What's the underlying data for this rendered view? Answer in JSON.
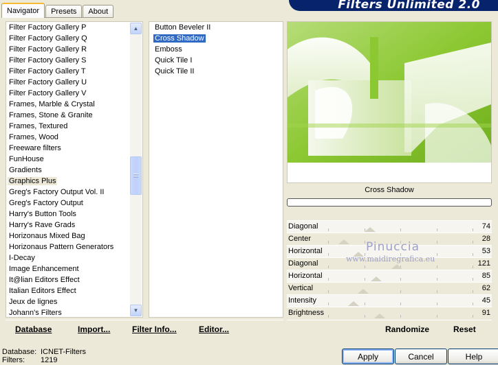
{
  "tabs": [
    {
      "label": "Navigator",
      "active": true
    },
    {
      "label": "Presets",
      "active": false
    },
    {
      "label": "About",
      "active": false
    }
  ],
  "banner_title": "Filters Unlimited 2.0",
  "categories": [
    "Filter Factory Gallery P",
    "Filter Factory Gallery Q",
    "Filter Factory Gallery R",
    "Filter Factory Gallery S",
    "Filter Factory Gallery T",
    "Filter Factory Gallery U",
    "Filter Factory Gallery V",
    "Frames, Marble & Crystal",
    "Frames, Stone & Granite",
    "Frames, Textured",
    "Frames, Wood",
    "Freeware filters",
    "FunHouse",
    "Gradients",
    "Graphics Plus",
    "Greg's Factory Output Vol. II",
    "Greg's Factory Output",
    "Harry's Button Tools",
    "Harry's Rave Grads",
    "Horizonaus Mixed Bag",
    "Horizonaus Pattern Generators",
    "I-Decay",
    "Image Enhancement",
    "It@lian Editors Effect",
    "Italian Editors Effect",
    "Jeux de lignes",
    "Johann's Filters"
  ],
  "selected_category": "Graphics Plus",
  "filters": [
    "Button Beveler II",
    "Cross Shadow",
    "Emboss",
    "Quick Tile I",
    "Quick Tile II"
  ],
  "selected_filter": "Cross Shadow",
  "left_bar": {
    "database": "Database",
    "import": "Import...",
    "filter_info": "Filter Info...",
    "editor": "Editor..."
  },
  "preview_caption": "Cross Shadow",
  "progress": 0,
  "sliders": [
    {
      "label": "Diagonal",
      "value": "74"
    },
    {
      "label": "Center",
      "value": "28"
    },
    {
      "label": "Horizontal",
      "value": "53"
    },
    {
      "label": "Diagonal",
      "value": "121"
    },
    {
      "label": "Horizontal",
      "value": "85"
    },
    {
      "label": "Vertical",
      "value": "62"
    },
    {
      "label": "Intensity",
      "value": "45"
    },
    {
      "label": "Brightness",
      "value": "91"
    }
  ],
  "right_bar": {
    "randomize": "Randomize",
    "reset": "Reset"
  },
  "watermark": {
    "name": "Pinuccia",
    "site": "www.maidiregrafica.eu"
  },
  "status": {
    "database_label": "Database:",
    "database_value": "ICNET-Filters",
    "filters_label": "Filters:",
    "filters_value": "1219"
  },
  "buttons": {
    "apply": "Apply",
    "cancel": "Cancel",
    "help": "Help"
  },
  "colors": {
    "selection": "#316ac5",
    "preview_green": "#8cc832",
    "banner": "#06236b"
  }
}
